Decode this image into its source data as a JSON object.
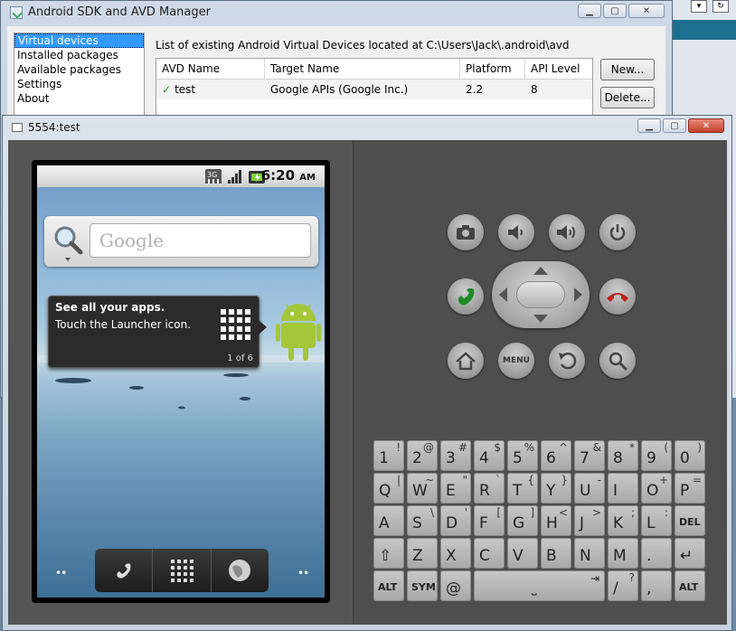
{
  "sdk_window": {
    "title": "Android SDK and AVD Manager",
    "sidebar": [
      "Virtual devices",
      "Installed packages",
      "Available packages",
      "Settings",
      "About"
    ],
    "list_caption": "List of existing Android Virtual Devices located at C:\\Users\\Jack\\.android\\avd",
    "columns": [
      "AVD Name",
      "Target Name",
      "Platform",
      "API Level"
    ],
    "rows": [
      {
        "name": "test",
        "target": "Google APIs (Google Inc.)",
        "platform": "2.2",
        "api": "8"
      }
    ],
    "buttons": {
      "new": "New...",
      "delete": "Delete..."
    }
  },
  "emulator_window": {
    "title": "5554:test",
    "status_bar": {
      "time": "6:20",
      "ampm": "AM",
      "network": "3G"
    },
    "search_placeholder": "Google",
    "tip": {
      "title": "See all your apps.",
      "body": "Touch the Launcher icon.",
      "counter": "1 of 6"
    },
    "menu_label": "MENU",
    "dots": "••"
  },
  "keyboard": {
    "row1": [
      [
        "1",
        "!"
      ],
      [
        "2",
        "@"
      ],
      [
        "3",
        "#"
      ],
      [
        "4",
        "$"
      ],
      [
        "5",
        "%"
      ],
      [
        "6",
        "^"
      ],
      [
        "7",
        "&"
      ],
      [
        "8",
        "*"
      ],
      [
        "9",
        "("
      ],
      [
        "0",
        ")"
      ]
    ],
    "row2": [
      [
        "Q",
        "|"
      ],
      [
        "W",
        "~"
      ],
      [
        "E",
        "\""
      ],
      [
        "R",
        "`"
      ],
      [
        "T",
        "{"
      ],
      [
        "Y",
        "}"
      ],
      [
        "U",
        "-"
      ],
      [
        "I",
        ""
      ],
      [
        "O",
        "+"
      ],
      [
        "P",
        "="
      ]
    ],
    "row3": [
      [
        "A",
        ""
      ],
      [
        "S",
        "\\"
      ],
      [
        "D",
        "'"
      ],
      [
        "F",
        "["
      ],
      [
        "G",
        "]"
      ],
      [
        "H",
        "<"
      ],
      [
        "J",
        ">"
      ],
      [
        "K",
        ";"
      ],
      [
        "L",
        ":"
      ],
      [
        "DEL",
        ""
      ]
    ],
    "row4": [
      [
        "⇧",
        ""
      ],
      [
        "Z",
        ""
      ],
      [
        "X",
        ""
      ],
      [
        "C",
        ""
      ],
      [
        "V",
        ""
      ],
      [
        "B",
        ""
      ],
      [
        "N",
        ""
      ],
      [
        "M",
        ""
      ],
      [
        ".",
        ""
      ],
      [
        "↵",
        ""
      ]
    ],
    "row5_alt": "ALT",
    "row5_sym": "SYM",
    "row5_at": "@",
    "row5_slash": "/",
    "row5_slash_alt": "?",
    "row5_comma": ","
  },
  "colors": {
    "selection": "#3399ff",
    "skin": "#545454",
    "close_button": "#c2412a"
  }
}
